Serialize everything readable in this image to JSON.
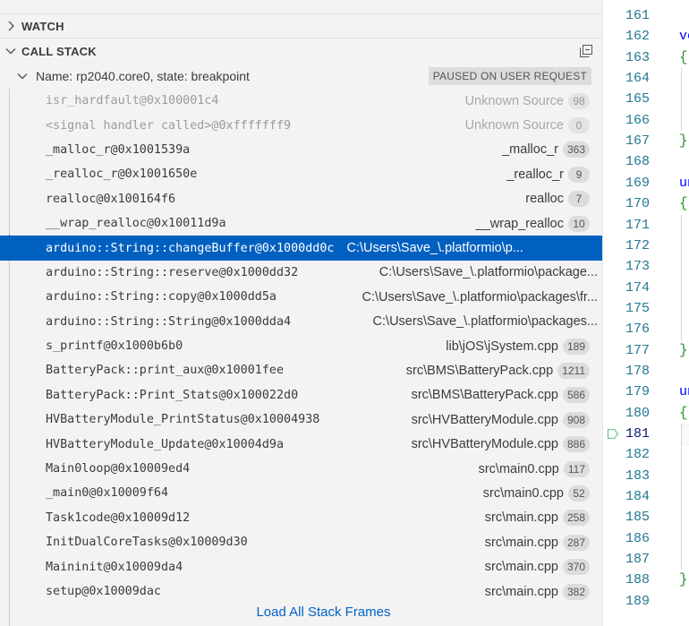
{
  "watch": {
    "label": "WATCH"
  },
  "call_stack": {
    "label": "CALL STACK",
    "thread": {
      "label": "Name: rp2040.core0, state: breakpoint",
      "status_badge": "PAUSED ON USER REQUEST"
    },
    "frames": [
      {
        "name": "isr_hardfault@0x100001c4",
        "source": "Unknown Source",
        "line": "98",
        "dim": true
      },
      {
        "name": "<signal handler called>@0xfffffff9",
        "source": "Unknown Source",
        "line": "0",
        "dim": true
      },
      {
        "name": "_malloc_r@0x1001539a",
        "source": "_malloc_r",
        "line": "363"
      },
      {
        "name": "_realloc_r@0x1001650e",
        "source": "_realloc_r",
        "line": "9"
      },
      {
        "name": "realloc@0x100164f6",
        "source": "realloc",
        "line": "7"
      },
      {
        "name": "__wrap_realloc@0x10011d9a",
        "source": "__wrap_realloc",
        "line": "10"
      },
      {
        "name": "arduino::String::changeBuffer@0x1000dd0c",
        "source": "C:\\Users\\Save_\\.platformio\\p...",
        "line": "",
        "selected": true
      },
      {
        "name": "arduino::String::reserve@0x1000dd32",
        "source": "C:\\Users\\Save_\\.platformio\\package...",
        "line": ""
      },
      {
        "name": "arduino::String::copy@0x1000dd5a",
        "source": "C:\\Users\\Save_\\.platformio\\packages\\fr...",
        "line": ""
      },
      {
        "name": "arduino::String::String@0x1000dda4",
        "source": "C:\\Users\\Save_\\.platformio\\packages...",
        "line": ""
      },
      {
        "name": "s_printf@0x1000b6b0",
        "source": "lib\\jOS\\jSystem.cpp",
        "line": "189"
      },
      {
        "name": "BatteryPack::print_aux@0x10001fee",
        "source": "src\\BMS\\BatteryPack.cpp",
        "line": "1211"
      },
      {
        "name": "BatteryPack::Print_Stats@0x100022d0",
        "source": "src\\BMS\\BatteryPack.cpp",
        "line": "586"
      },
      {
        "name": "HVBatteryModule_PrintStatus@0x10004938",
        "source": "src\\HVBatteryModule.cpp",
        "line": "908"
      },
      {
        "name": "HVBatteryModule_Update@0x10004d9a",
        "source": "src\\HVBatteryModule.cpp",
        "line": "886"
      },
      {
        "name": "Main0loop@0x10009ed4",
        "source": "src\\main0.cpp",
        "line": "117"
      },
      {
        "name": "_main0@0x10009f64",
        "source": "src\\main0.cpp",
        "line": "52"
      },
      {
        "name": "Task1code@0x10009d12",
        "source": "src\\main.cpp",
        "line": "258"
      },
      {
        "name": "InitDualCoreTasks@0x10009d30",
        "source": "src\\main.cpp",
        "line": "287"
      },
      {
        "name": "Maininit@0x10009da4",
        "source": "src\\main.cpp",
        "line": "370"
      },
      {
        "name": "setup@0x10009dac",
        "source": "src\\main.cpp",
        "line": "382"
      }
    ],
    "load_all": "Load All Stack Frames"
  },
  "editor": {
    "line_numbers": [
      "161",
      "162",
      "163",
      "164",
      "165",
      "166",
      "167",
      "168",
      "169",
      "170",
      "171",
      "172",
      "173",
      "174",
      "175",
      "176",
      "177",
      "178",
      "179",
      "180",
      "181",
      "182",
      "183",
      "184",
      "185",
      "186",
      "187",
      "188",
      "189"
    ],
    "current_line": "181",
    "code_fragments": [
      {
        "line": "162",
        "text": "vo",
        "color": "#0000ff"
      },
      {
        "line": "169",
        "text": "un",
        "color": "#0000ff"
      },
      {
        "line": "179",
        "text": "un",
        "color": "#0000ff"
      }
    ],
    "braces": [
      {
        "line": "163",
        "text": "{"
      },
      {
        "line": "167",
        "text": "}"
      },
      {
        "line": "170",
        "text": "{"
      },
      {
        "line": "177",
        "text": "}"
      },
      {
        "line": "180",
        "text": "{"
      },
      {
        "line": "188",
        "text": "}"
      }
    ]
  }
}
